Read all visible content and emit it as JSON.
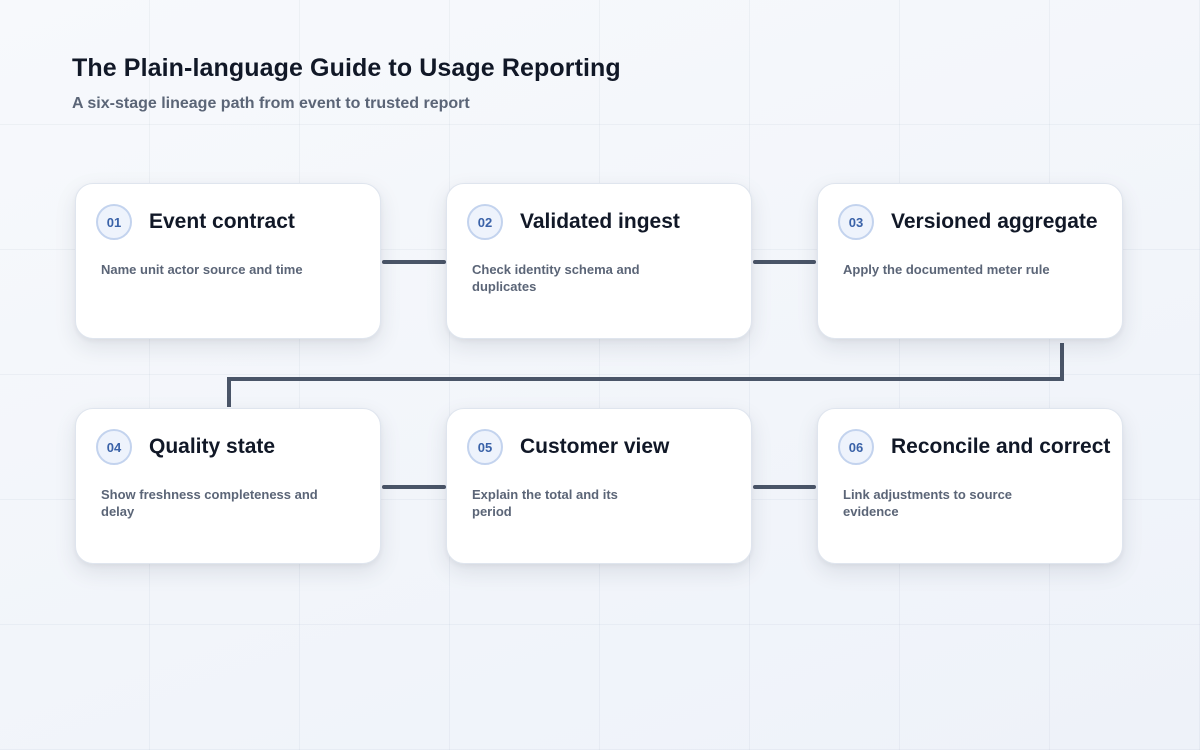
{
  "header": {
    "title": "The Plain-language Guide to Usage Reporting",
    "subtitle": "A six-stage lineage path from event to trusted report"
  },
  "stages": [
    {
      "number": "01",
      "title": "Event contract",
      "description": "Name unit actor source and time"
    },
    {
      "number": "02",
      "title": "Validated ingest",
      "description": "Check identity schema and duplicates"
    },
    {
      "number": "03",
      "title": "Versioned aggregate",
      "description": "Apply the documented meter rule"
    },
    {
      "number": "04",
      "title": "Quality state",
      "description": "Show freshness completeness and delay"
    },
    {
      "number": "05",
      "title": "Customer view",
      "description": "Explain the total and its period"
    },
    {
      "number": "06",
      "title": "Reconcile and correct",
      "description": "Link adjustments to source evidence"
    }
  ],
  "colors": {
    "connector": "#4a5568",
    "badge_text": "#3a62a8",
    "title_text": "#111827",
    "body_text": "#5b6577"
  }
}
